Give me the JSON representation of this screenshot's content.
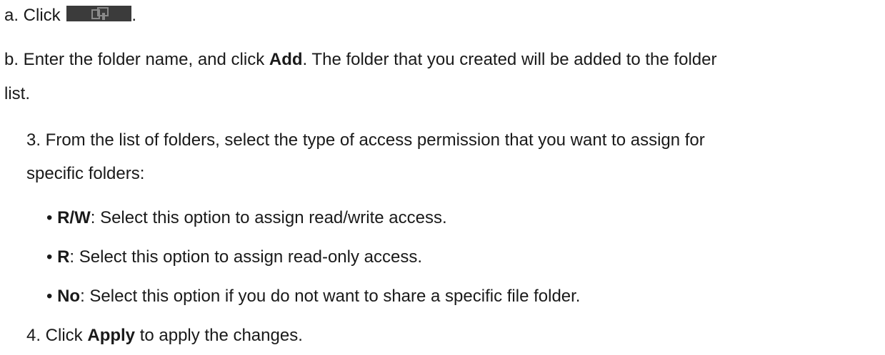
{
  "steps": {
    "a": {
      "prefix": "a. Click",
      "suffix": ".",
      "icon": "add-folder-icon"
    },
    "b": {
      "prefix": "b. Enter the folder name, and click ",
      "bold": "Add",
      "suffix_line1": ". The folder that you created will be added to the folder",
      "line2": "list."
    },
    "step3": {
      "line1": "3. From the list of folders, select the type of access permission that you want to assign for",
      "line2": "specific folders:"
    },
    "options": [
      {
        "bullet": "• ",
        "label": "R/W",
        "text": ": Select this option to assign read/write access."
      },
      {
        "bullet": "• ",
        "label": "R",
        "text": ": Select this option to assign read-only access."
      },
      {
        "bullet": "• ",
        "label": "No",
        "text": ": Select this option if you do not want to share a specific file folder."
      }
    ],
    "step4": {
      "prefix": "4. Click ",
      "bold": "Apply",
      "suffix": " to apply the changes."
    }
  }
}
